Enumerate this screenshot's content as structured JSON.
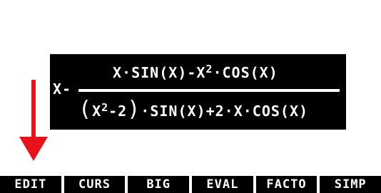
{
  "expression": {
    "prefix": "X-",
    "numerator": {
      "a": "X·SIN(X)-X",
      "exp": "2",
      "b": "·COS(X)"
    },
    "denominator": {
      "open": "(",
      "x": "X",
      "exp": "2",
      "minus": "-2",
      "close": ")",
      "rest": "·SIN(X)+2·X·COS(X)"
    }
  },
  "annotation": {
    "arrow_color": "#e8121a",
    "icon": "down-arrow-icon"
  },
  "menu": {
    "items": [
      {
        "label": "EDIT"
      },
      {
        "label": "CURS"
      },
      {
        "label": "BIG"
      },
      {
        "label": "EVAL"
      },
      {
        "label": "FACTO"
      },
      {
        "label": "SIMP"
      }
    ]
  }
}
